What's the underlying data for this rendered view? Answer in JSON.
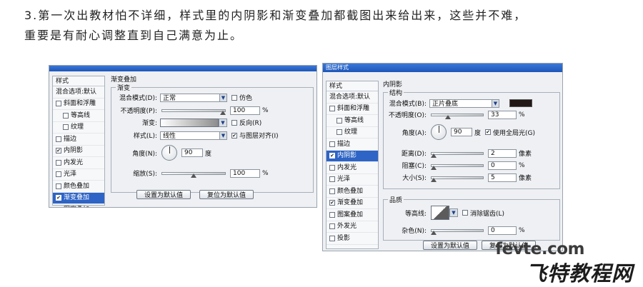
{
  "caption": {
    "line1": "3.第一次出教材怕不详细，样式里的内阴影和渐变叠加都截图出来给出来，这些并不难，",
    "line2": "重要是有耐心调整直到自己满意为止。"
  },
  "left_dialog": {
    "sidebar": {
      "header": "样式",
      "blend": "混合选项:默认",
      "items": [
        {
          "label": "斜面和浮雕",
          "checked": false
        },
        {
          "label": "等高线",
          "checked": false
        },
        {
          "label": "纹理",
          "checked": false
        },
        {
          "label": "描边",
          "checked": false
        },
        {
          "label": "内阴影",
          "checked": true
        },
        {
          "label": "内发光",
          "checked": false
        },
        {
          "label": "光泽",
          "checked": false
        },
        {
          "label": "颜色叠加",
          "checked": false
        },
        {
          "label": "渐变叠加",
          "checked": true
        },
        {
          "label": "图案叠加",
          "checked": false
        }
      ]
    },
    "panel_title": "渐变叠加",
    "group_title": "渐变",
    "blend_mode_label": "混合模式(D):",
    "blend_mode_value": "正常",
    "dither_label": "仿色",
    "opacity_label": "不透明度(P):",
    "opacity_value": "100",
    "gradient_label": "渐变:",
    "reverse_label": "反向(R)",
    "style_label": "样式(L):",
    "style_value": "线性",
    "align_label": "与图层对齐(I)",
    "angle_label": "角度(N):",
    "angle_value": "90",
    "degree_unit": "度",
    "scale_label": "缩放(S):",
    "scale_value": "100",
    "percent": "%",
    "btn_default": "设置为默认值",
    "btn_reset": "复位为默认值",
    "opacity_level": 1.0,
    "scale_level": 0.5
  },
  "right_dialog": {
    "title": "图层样式",
    "sidebar": {
      "header": "样式",
      "blend": "混合选项:默认",
      "items": [
        {
          "label": "斜面和浮雕",
          "checked": false
        },
        {
          "label": "等高线",
          "checked": false
        },
        {
          "label": "纹理",
          "checked": false
        },
        {
          "label": "描边",
          "checked": false
        },
        {
          "label": "内阴影",
          "checked": true
        },
        {
          "label": "内发光",
          "checked": false
        },
        {
          "label": "光泽",
          "checked": false
        },
        {
          "label": "颜色叠加",
          "checked": false
        },
        {
          "label": "渐变叠加",
          "checked": true
        },
        {
          "label": "图案叠加",
          "checked": false
        },
        {
          "label": "外发光",
          "checked": false
        },
        {
          "label": "投影",
          "checked": false
        }
      ]
    },
    "panel_title": "内阴影",
    "group_structure": "结构",
    "blend_mode_label": "混合模式(B):",
    "blend_mode_value": "正片叠底",
    "shadow_color": "#231815",
    "opacity_label": "不透明度(O):",
    "opacity_value": "33",
    "angle_label": "角度(A):",
    "angle_value": "90",
    "degree_unit": "度",
    "global_light_label": "使用全局光(G)",
    "distance_label": "距离(D):",
    "distance_value": "2",
    "choke_label": "阻塞(C):",
    "choke_value": "0",
    "size_label": "大小(S):",
    "size_value": "5",
    "px": "像素",
    "percent": "%",
    "group_quality": "品质",
    "contour_label": "等高线:",
    "antialias_label": "消除锯齿(L)",
    "noise_label": "杂色(N):",
    "noise_value": "0",
    "btn_default": "设置为默认值",
    "btn_reset": "复位为默认值",
    "opacity_level": 0.33,
    "distance_level": 0.02,
    "choke_level": 0.0,
    "size_level": 0.02,
    "noise_level": 0.0
  },
  "watermark": {
    "site": "fevte.com",
    "name": "飞特教程网"
  }
}
